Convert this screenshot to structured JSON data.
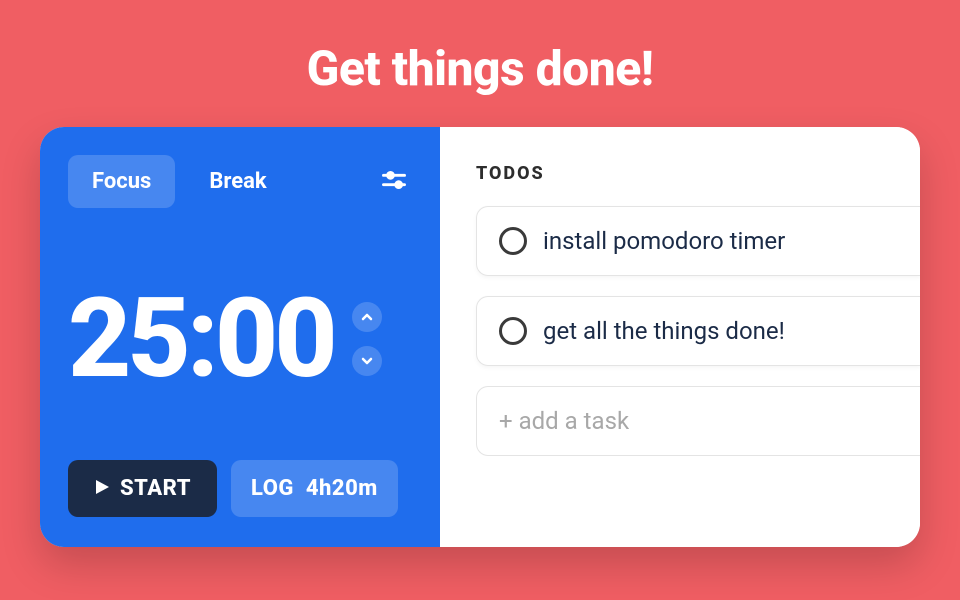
{
  "page_title": "Get things done!",
  "timer": {
    "tabs": {
      "focus": "Focus",
      "break": "Break",
      "active": "focus"
    },
    "display": "25:00",
    "start_label": "START",
    "log_label": "LOG",
    "log_value": "4h20m"
  },
  "todos": {
    "title": "TODOS",
    "items": [
      {
        "text": "install pomodoro timer"
      },
      {
        "text": "get all the things done!"
      }
    ],
    "add_placeholder": "+ add a task"
  },
  "colors": {
    "bg": "#f05e63",
    "panel": "#1f6ded",
    "start": "#1b2b47"
  }
}
